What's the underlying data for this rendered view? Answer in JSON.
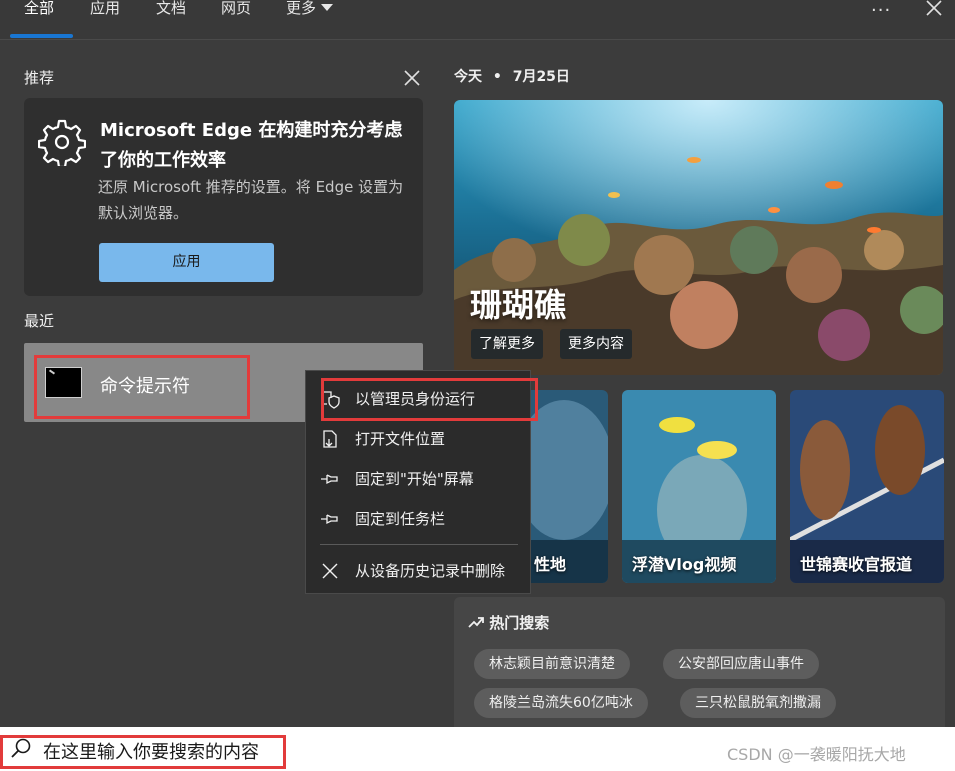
{
  "tabs": [
    {
      "label": "全部",
      "active": true
    },
    {
      "label": "应用"
    },
    {
      "label": "文档"
    },
    {
      "label": "网页"
    },
    {
      "label": "更多"
    }
  ],
  "recommended": {
    "heading": "推荐",
    "card_title": "Microsoft Edge 在构建时充分考虑了你的工作效率",
    "card_desc": "还原 Microsoft 推荐的设置。将 Edge 设置为默认浏览器。",
    "apply_label": "应用"
  },
  "recent": {
    "heading": "最近",
    "items": [
      {
        "label": "命令提示符",
        "icon": "command-prompt-icon"
      }
    ]
  },
  "context_menu": {
    "items": [
      {
        "label": "以管理员身份运行",
        "icon": "shield-icon"
      },
      {
        "label": "打开文件位置",
        "icon": "file-location-icon"
      },
      {
        "label": "固定到\"开始\"屏幕",
        "icon": "pin-icon"
      },
      {
        "label": "固定到任务栏",
        "icon": "pin-icon"
      },
      {
        "label": "从设备历史记录中删除",
        "icon": "close-icon"
      }
    ]
  },
  "today": {
    "label": "今天",
    "separator": "•",
    "date": "7月25日",
    "hero_title": "珊瑚礁",
    "hero_buttons": [
      "了解更多",
      "更多内容"
    ],
    "cards": [
      "性地",
      "浮潜Vlog视频",
      "世锦赛收官报道"
    ]
  },
  "hot_search": {
    "title": "热门搜索",
    "chips": [
      "林志颖目前意识清楚",
      "公安部回应唐山事件",
      "格陵兰岛流失60亿吨冰",
      "三只松鼠脱氧剂撒漏"
    ]
  },
  "search": {
    "placeholder": "在这里输入你要搜索的内容"
  },
  "watermark": "CSDN @一袭暖阳抚大地",
  "colors": {
    "accent": "#1976d2",
    "apply_button": "#79b8ec",
    "highlight_box": "#e23b3b"
  }
}
